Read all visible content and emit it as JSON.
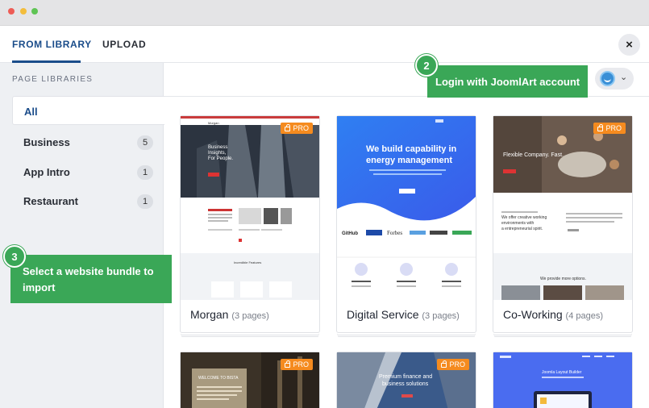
{
  "tabs": {
    "library": "FROM LIBRARY",
    "upload": "UPLOAD",
    "close": "×"
  },
  "sidebar": {
    "title": "PAGE LIBRARIES",
    "categories": [
      {
        "label": "All",
        "count": ""
      },
      {
        "label": "Business",
        "count": "5"
      },
      {
        "label": "App Intro",
        "count": "1"
      },
      {
        "label": "Restaurant",
        "count": "1"
      }
    ]
  },
  "callouts": {
    "login": {
      "number": "2",
      "text": "Login with JoomlArt account"
    },
    "bundle": {
      "number": "3",
      "text": "Select a website bundle to import"
    }
  },
  "pro_label": "PRO",
  "cards": [
    {
      "name": "Morgan",
      "pages": "(3 pages)",
      "pro": true,
      "thumb": {
        "nav_brand": "Morgan",
        "headline": "Business Insights, For People.",
        "section_title": "Incredible Features"
      }
    },
    {
      "name": "Digital Service",
      "pages": "(3 pages)",
      "pro": false,
      "thumb": {
        "headline": "We build capability in energy management",
        "logos": [
          "GitHub",
          "Forbes"
        ]
      }
    },
    {
      "name": "Co-Working",
      "pages": "(4 pages)",
      "pro": true,
      "thumb": {
        "headline": "Flexible Company. Fast.",
        "subhead": "We offer creative working environments with a entrepreneurial spirit.",
        "more": "We provide more options."
      }
    },
    {
      "name": "",
      "pages": "",
      "pro": true,
      "thumb": {
        "headline": "WELCOME TO BISTA"
      }
    },
    {
      "name": "",
      "pages": "",
      "pro": true,
      "thumb": {
        "headline": "Premium finance and business solutions"
      }
    },
    {
      "name": "",
      "pages": "",
      "pro": false,
      "thumb": {
        "headline": "Joomla Layout Builder"
      }
    }
  ],
  "colors": {
    "accent": "#1a4c8a",
    "callout": "#3aa757",
    "pro": "#f58b1f"
  }
}
